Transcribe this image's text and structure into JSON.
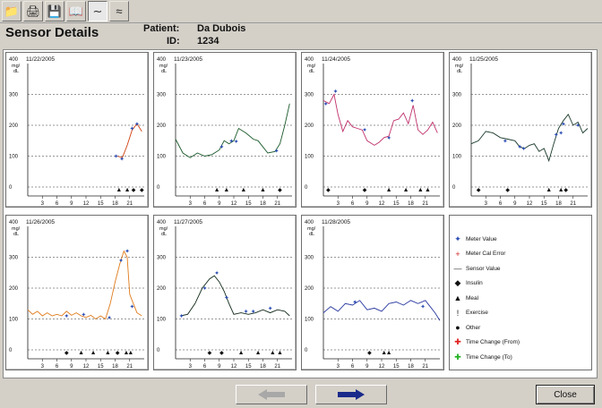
{
  "window": {
    "title": "Sensor Details"
  },
  "toolbar": {
    "icons": [
      "open-folder-icon",
      "print-icon",
      "save-icon",
      "book-icon",
      "graph-icon",
      "chart-icon"
    ]
  },
  "patient": {
    "label": "Patient:",
    "name": "Da Dubois",
    "id_label": "ID:",
    "id": "1234"
  },
  "buttons": {
    "close": "Close"
  },
  "chart_data": [
    {
      "type": "line",
      "title": "11/22/2005",
      "ylabel": "mg/dL",
      "y_axis_label_top": "400 mg/ dL",
      "ylim": [
        0,
        400
      ],
      "xlim": [
        0,
        24
      ],
      "yticks": [
        "300",
        "200",
        "100",
        "0"
      ],
      "xticks": [
        "3",
        "6",
        "9",
        "12",
        "15",
        "18",
        "21"
      ],
      "sensor": [
        [
          18.5,
          100
        ],
        [
          19.5,
          95
        ],
        [
          20.5,
          135
        ],
        [
          21.5,
          185
        ],
        [
          22.5,
          205
        ],
        [
          23.5,
          180
        ]
      ],
      "meter": [
        [
          18.2,
          100
        ],
        [
          19.4,
          92
        ],
        [
          21.5,
          190
        ],
        [
          22.5,
          205
        ]
      ],
      "events": [
        [
          18.8,
          "meal"
        ],
        [
          20.5,
          "meal"
        ],
        [
          21.8,
          "insulin"
        ],
        [
          23.5,
          "insulin"
        ]
      ]
    },
    {
      "type": "line",
      "title": "11/23/2005",
      "ylabel": "mg/dL",
      "ylim": [
        0,
        400
      ],
      "xlim": [
        0,
        24
      ],
      "yticks": [
        "300",
        "200",
        "100",
        "0"
      ],
      "xticks": [
        "3",
        "6",
        "9",
        "12",
        "15",
        "18",
        "21"
      ],
      "sensor": [
        [
          0,
          155
        ],
        [
          1.5,
          110
        ],
        [
          3,
          95
        ],
        [
          4.5,
          110
        ],
        [
          6,
          100
        ],
        [
          7.5,
          105
        ],
        [
          9,
          120
        ],
        [
          10,
          150
        ],
        [
          11,
          140
        ],
        [
          12,
          150
        ],
        [
          13,
          190
        ],
        [
          14.5,
          175
        ],
        [
          16,
          155
        ],
        [
          17,
          150
        ],
        [
          18,
          130
        ],
        [
          19,
          110
        ],
        [
          20.5,
          115
        ],
        [
          21.5,
          140
        ],
        [
          22.5,
          200
        ],
        [
          23.5,
          270
        ]
      ],
      "meter": [
        [
          9.5,
          130
        ],
        [
          11.5,
          150
        ],
        [
          12.5,
          148
        ],
        [
          20.8,
          118
        ]
      ],
      "events": [
        [
          8.5,
          "meal"
        ],
        [
          10.5,
          "meal"
        ],
        [
          14,
          "meal"
        ],
        [
          18,
          "meal"
        ],
        [
          21.5,
          "insulin"
        ]
      ]
    },
    {
      "type": "line",
      "title": "11/24/2005",
      "ylabel": "mg/dL",
      "ylim": [
        0,
        400
      ],
      "xlim": [
        0,
        24
      ],
      "yticks": [
        "300",
        "200",
        "100",
        "0"
      ],
      "xticks": [
        "3",
        "6",
        "9",
        "12",
        "15",
        "18",
        "21"
      ],
      "sensor": [
        [
          0,
          280
        ],
        [
          1.2,
          270
        ],
        [
          2.2,
          300
        ],
        [
          3,
          235
        ],
        [
          4,
          180
        ],
        [
          5,
          215
        ],
        [
          6,
          195
        ],
        [
          7,
          190
        ],
        [
          8,
          185
        ],
        [
          9,
          150
        ],
        [
          10.5,
          135
        ],
        [
          11.5,
          145
        ],
        [
          12.5,
          160
        ],
        [
          13.5,
          165
        ],
        [
          14.5,
          215
        ],
        [
          15.5,
          220
        ],
        [
          16.5,
          240
        ],
        [
          17.5,
          205
        ],
        [
          18.5,
          265
        ],
        [
          19.5,
          185
        ],
        [
          20.5,
          170
        ],
        [
          21.5,
          185
        ],
        [
          22.5,
          210
        ],
        [
          23.5,
          175
        ]
      ],
      "meter": [
        [
          0.5,
          270
        ],
        [
          2.5,
          310
        ],
        [
          8.5,
          185
        ],
        [
          13.5,
          160
        ],
        [
          18.3,
          280
        ]
      ],
      "events": [
        [
          1,
          "insulin"
        ],
        [
          8.5,
          "insulin"
        ],
        [
          13.5,
          "meal"
        ],
        [
          17,
          "meal"
        ],
        [
          20,
          "meal"
        ],
        [
          21.5,
          "meal"
        ]
      ]
    },
    {
      "type": "line",
      "title": "11/25/2005",
      "ylabel": "mg/dL",
      "ylim": [
        0,
        400
      ],
      "xlim": [
        0,
        24
      ],
      "yticks": [
        "300",
        "200",
        "100",
        "0"
      ],
      "xticks": [
        "3",
        "6",
        "9",
        "12",
        "15",
        "18",
        "21"
      ],
      "sensor": [
        [
          0,
          140
        ],
        [
          1.5,
          150
        ],
        [
          3,
          180
        ],
        [
          4.5,
          175
        ],
        [
          6,
          160
        ],
        [
          7.5,
          155
        ],
        [
          9,
          150
        ],
        [
          10,
          130
        ],
        [
          11,
          125
        ],
        [
          12,
          135
        ],
        [
          13,
          140
        ],
        [
          14,
          115
        ],
        [
          15,
          125
        ],
        [
          16,
          85
        ],
        [
          17,
          140
        ],
        [
          18,
          190
        ],
        [
          19,
          215
        ],
        [
          20,
          235
        ],
        [
          21,
          200
        ],
        [
          22,
          210
        ],
        [
          23,
          175
        ],
        [
          24,
          190
        ]
      ],
      "meter": [
        [
          7,
          150
        ],
        [
          10,
          130
        ],
        [
          10.8,
          125
        ],
        [
          17.5,
          170
        ],
        [
          18.5,
          175
        ],
        [
          19,
          205
        ],
        [
          22,
          200
        ]
      ],
      "events": [
        [
          1.5,
          "insulin"
        ],
        [
          7.5,
          "insulin"
        ],
        [
          16,
          "meal"
        ],
        [
          18.5,
          "meal"
        ],
        [
          19.5,
          "insulin"
        ]
      ]
    },
    {
      "type": "line",
      "title": "11/26/2005",
      "ylabel": "mg/dL",
      "ylim": [
        0,
        400
      ],
      "xlim": [
        0,
        24
      ],
      "yticks": [
        "300",
        "200",
        "100",
        "0"
      ],
      "xticks": [
        "3",
        "6",
        "9",
        "12",
        "15",
        "18",
        "21"
      ],
      "sensor": [
        [
          0,
          130
        ],
        [
          1,
          115
        ],
        [
          2,
          125
        ],
        [
          3,
          110
        ],
        [
          4,
          120
        ],
        [
          5,
          110
        ],
        [
          6,
          115
        ],
        [
          7,
          110
        ],
        [
          8,
          125
        ],
        [
          9,
          112
        ],
        [
          10,
          120
        ],
        [
          11,
          110
        ],
        [
          12,
          105
        ],
        [
          13,
          112
        ],
        [
          14,
          100
        ],
        [
          15,
          110
        ],
        [
          16,
          100
        ],
        [
          17,
          150
        ],
        [
          18,
          220
        ],
        [
          19,
          280
        ],
        [
          19.8,
          320
        ],
        [
          20.5,
          300
        ],
        [
          21,
          180
        ],
        [
          21.5,
          160
        ],
        [
          22.5,
          120
        ],
        [
          23.5,
          110
        ]
      ],
      "meter": [
        [
          8,
          110
        ],
        [
          11.5,
          115
        ],
        [
          16.8,
          105
        ],
        [
          19.2,
          290
        ],
        [
          20.5,
          320
        ],
        [
          21.5,
          140
        ]
      ],
      "events": [
        [
          8,
          "insulin"
        ],
        [
          11,
          "meal"
        ],
        [
          13.5,
          "meal"
        ],
        [
          16.5,
          "meal"
        ],
        [
          18.5,
          "insulin"
        ],
        [
          20.3,
          "meal"
        ],
        [
          21.2,
          "meal"
        ]
      ]
    },
    {
      "type": "line",
      "title": "11/27/2005",
      "ylabel": "mg/dL",
      "ylim": [
        0,
        400
      ],
      "xlim": [
        0,
        24
      ],
      "yticks": [
        "300",
        "200",
        "100",
        "0"
      ],
      "xticks": [
        "3",
        "6",
        "9",
        "12",
        "15",
        "18",
        "21"
      ],
      "sensor": [
        [
          1,
          110
        ],
        [
          2.5,
          115
        ],
        [
          4,
          150
        ],
        [
          5.5,
          200
        ],
        [
          7,
          230
        ],
        [
          8,
          240
        ],
        [
          9,
          220
        ],
        [
          10,
          190
        ],
        [
          11,
          150
        ],
        [
          12,
          115
        ],
        [
          13.5,
          120
        ],
        [
          15,
          115
        ],
        [
          16.5,
          120
        ],
        [
          18,
          130
        ],
        [
          19.5,
          120
        ],
        [
          21,
          130
        ],
        [
          22.5,
          125
        ],
        [
          23.5,
          110
        ]
      ],
      "meter": [
        [
          1.2,
          110
        ],
        [
          6,
          200
        ],
        [
          8.5,
          250
        ],
        [
          10.5,
          170
        ],
        [
          14.5,
          125
        ],
        [
          16,
          125
        ],
        [
          19.5,
          135
        ]
      ],
      "events": [
        [
          7,
          "insulin"
        ],
        [
          9.5,
          "insulin"
        ],
        [
          13.5,
          "meal"
        ],
        [
          17,
          "meal"
        ],
        [
          20,
          "meal"
        ],
        [
          21.5,
          "meal"
        ]
      ]
    },
    {
      "type": "line",
      "title": "11/28/2005",
      "ylabel": "mg/dL",
      "ylim": [
        0,
        400
      ],
      "xlim": [
        0,
        24
      ],
      "yticks": [
        "300",
        "200",
        "100",
        "0"
      ],
      "xticks": [
        "3",
        "6",
        "9",
        "12",
        "15",
        "18",
        "21"
      ],
      "sensor": [
        [
          0,
          120
        ],
        [
          1.5,
          140
        ],
        [
          3,
          125
        ],
        [
          4.5,
          150
        ],
        [
          6,
          145
        ],
        [
          7.5,
          160
        ],
        [
          9,
          130
        ],
        [
          10.5,
          135
        ],
        [
          12,
          125
        ],
        [
          13.5,
          150
        ],
        [
          15,
          155
        ],
        [
          16.5,
          145
        ],
        [
          18,
          160
        ],
        [
          19.5,
          150
        ],
        [
          21,
          160
        ],
        [
          22,
          140
        ],
        [
          23,
          120
        ],
        [
          24,
          95
        ]
      ],
      "meter": [
        [
          6.5,
          155
        ],
        [
          20.5,
          140
        ]
      ],
      "events": [
        [
          9.5,
          "insulin"
        ],
        [
          12.5,
          "meal"
        ],
        [
          13.5,
          "meal"
        ]
      ]
    }
  ],
  "legend": {
    "items": [
      {
        "symbol": "✦",
        "color": "#2b4db3",
        "label": "Meter Value"
      },
      {
        "symbol": "+",
        "color": "#d02020",
        "label": "Meter Cal Error"
      },
      {
        "symbol": "—",
        "color": "#333333",
        "label": "Sensor Value"
      },
      {
        "symbol": "◆",
        "color": "#111111",
        "label": "Insulin"
      },
      {
        "symbol": "▲",
        "color": "#111111",
        "label": "Meal"
      },
      {
        "symbol": "!",
        "color": "#111111",
        "label": "Exercise"
      },
      {
        "symbol": "●",
        "color": "#111111",
        "label": "Other"
      },
      {
        "symbol": "✚",
        "color": "#e02020",
        "label": "Time Change (From)"
      },
      {
        "symbol": "✚",
        "color": "#20b020",
        "label": "Time Change (To)"
      }
    ]
  },
  "colors": {
    "line_colors": [
      "#d04010",
      "#1a5a2a",
      "#c0306a",
      "#1a3a2a",
      "#e07a1a",
      "#112a1a",
      "#2a3aa0"
    ]
  }
}
